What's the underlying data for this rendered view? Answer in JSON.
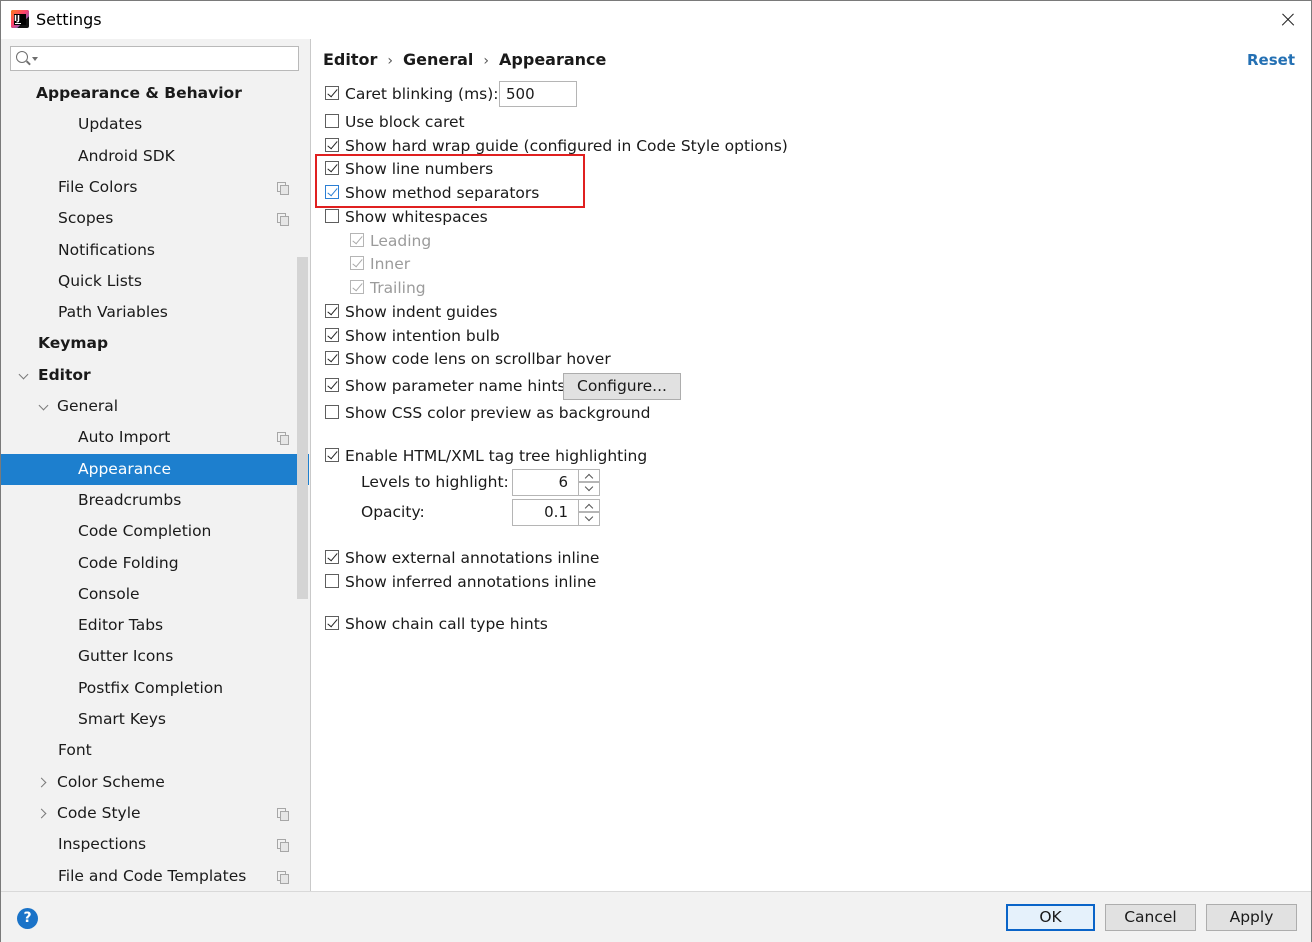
{
  "window": {
    "title": "Settings"
  },
  "search": {
    "placeholder": ""
  },
  "sidebar": {
    "items": [
      {
        "label": "Appearance & Behavior",
        "indent": 0,
        "bold": true,
        "arrow": "",
        "copy": false,
        "selected": false
      },
      {
        "label": "Updates",
        "indent": 2,
        "bold": false,
        "arrow": "",
        "copy": false,
        "selected": false
      },
      {
        "label": "Android SDK",
        "indent": 2,
        "bold": false,
        "arrow": "",
        "copy": false,
        "selected": false
      },
      {
        "label": "File Colors",
        "indent": 1,
        "bold": false,
        "arrow": "",
        "copy": true,
        "selected": false
      },
      {
        "label": "Scopes",
        "indent": 1,
        "bold": false,
        "arrow": "",
        "copy": true,
        "selected": false
      },
      {
        "label": "Notifications",
        "indent": 1,
        "bold": false,
        "arrow": "",
        "copy": false,
        "selected": false
      },
      {
        "label": "Quick Lists",
        "indent": 1,
        "bold": false,
        "arrow": "",
        "copy": false,
        "selected": false
      },
      {
        "label": "Path Variables",
        "indent": 1,
        "bold": false,
        "arrow": "",
        "copy": false,
        "selected": false
      },
      {
        "label": "Keymap",
        "indent": 0,
        "bold": true,
        "arrow": "",
        "copy": false,
        "selected": false
      },
      {
        "label": "Editor",
        "indent": 0,
        "bold": true,
        "arrow": "down",
        "copy": false,
        "selected": false
      },
      {
        "label": "General",
        "indent": 1,
        "bold": false,
        "arrow": "down",
        "copy": false,
        "selected": false
      },
      {
        "label": "Auto Import",
        "indent": 2,
        "bold": false,
        "arrow": "",
        "copy": true,
        "selected": false
      },
      {
        "label": "Appearance",
        "indent": 2,
        "bold": false,
        "arrow": "",
        "copy": false,
        "selected": true
      },
      {
        "label": "Breadcrumbs",
        "indent": 2,
        "bold": false,
        "arrow": "",
        "copy": false,
        "selected": false
      },
      {
        "label": "Code Completion",
        "indent": 2,
        "bold": false,
        "arrow": "",
        "copy": false,
        "selected": false
      },
      {
        "label": "Code Folding",
        "indent": 2,
        "bold": false,
        "arrow": "",
        "copy": false,
        "selected": false
      },
      {
        "label": "Console",
        "indent": 2,
        "bold": false,
        "arrow": "",
        "copy": false,
        "selected": false
      },
      {
        "label": "Editor Tabs",
        "indent": 2,
        "bold": false,
        "arrow": "",
        "copy": false,
        "selected": false
      },
      {
        "label": "Gutter Icons",
        "indent": 2,
        "bold": false,
        "arrow": "",
        "copy": false,
        "selected": false
      },
      {
        "label": "Postfix Completion",
        "indent": 2,
        "bold": false,
        "arrow": "",
        "copy": false,
        "selected": false
      },
      {
        "label": "Smart Keys",
        "indent": 2,
        "bold": false,
        "arrow": "",
        "copy": false,
        "selected": false
      },
      {
        "label": "Font",
        "indent": 1,
        "bold": false,
        "arrow": "",
        "copy": false,
        "selected": false
      },
      {
        "label": "Color Scheme",
        "indent": 1,
        "bold": false,
        "arrow": "right",
        "copy": false,
        "selected": false
      },
      {
        "label": "Code Style",
        "indent": 1,
        "bold": false,
        "arrow": "right",
        "copy": true,
        "selected": false
      },
      {
        "label": "Inspections",
        "indent": 1,
        "bold": false,
        "arrow": "",
        "copy": true,
        "selected": false
      },
      {
        "label": "File and Code Templates",
        "indent": 1,
        "bold": false,
        "arrow": "",
        "copy": true,
        "selected": false
      }
    ]
  },
  "breadcrumb": [
    "Editor",
    "General",
    "Appearance"
  ],
  "reset_label": "Reset",
  "options": {
    "caret_blinking": {
      "label": "Caret blinking (ms):",
      "checked": true,
      "value": "500"
    },
    "block_caret": {
      "label": "Use block caret",
      "checked": false
    },
    "hard_wrap": {
      "label": "Show hard wrap guide (configured in Code Style options)",
      "checked": true
    },
    "line_numbers": {
      "label": "Show line numbers",
      "checked": true
    },
    "method_separators": {
      "label": "Show method separators",
      "checked": true
    },
    "whitespaces": {
      "label": "Show whitespaces",
      "checked": false
    },
    "leading": {
      "label": "Leading",
      "checked": true
    },
    "inner": {
      "label": "Inner",
      "checked": true
    },
    "trailing": {
      "label": "Trailing",
      "checked": true
    },
    "indent_guides": {
      "label": "Show indent guides",
      "checked": true
    },
    "intention_bulb": {
      "label": "Show intention bulb",
      "checked": true
    },
    "code_lens": {
      "label": "Show code lens on scrollbar hover",
      "checked": true
    },
    "param_hints": {
      "label": "Show parameter name hints",
      "checked": true,
      "button": "Configure..."
    },
    "css_preview": {
      "label": "Show CSS color preview as background",
      "checked": false
    },
    "tag_tree": {
      "label": "Enable HTML/XML tag tree highlighting",
      "checked": true
    },
    "levels": {
      "label": "Levels to highlight:",
      "value": "6"
    },
    "opacity": {
      "label": "Opacity:",
      "value": "0.1"
    },
    "ext_annotations": {
      "label": "Show external annotations inline",
      "checked": true
    },
    "inf_annotations": {
      "label": "Show inferred annotations inline",
      "checked": false
    },
    "chain_hints": {
      "label": "Show chain call type hints",
      "checked": true
    }
  },
  "footer": {
    "ok": "OK",
    "cancel": "Cancel",
    "apply": "Apply",
    "help": "?"
  },
  "colors": {
    "selection": "#1d7fce",
    "link": "#2470b3",
    "highlight_box": "#e02020"
  }
}
